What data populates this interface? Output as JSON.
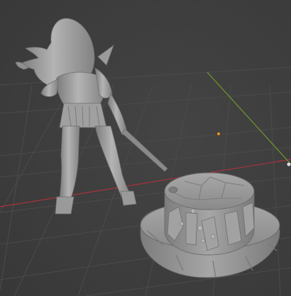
{
  "app": {
    "name": "3D Viewport",
    "view": "perspective"
  },
  "viewport": {
    "background_color": "#3e3e3e",
    "grid_color": "#4a4a4a",
    "x_axis_color": "#a8323d",
    "y_axis_color": "#6f9a2a",
    "origin_color": "#f0922a",
    "model_color": "#9a9a9a"
  },
  "scene": {
    "objects": [
      {
        "name": "warrior-figure",
        "kind": "sculpt"
      },
      {
        "name": "stone-base",
        "kind": "sculpt"
      }
    ],
    "origin_marker_visible": true,
    "light_marker_visible": true
  }
}
